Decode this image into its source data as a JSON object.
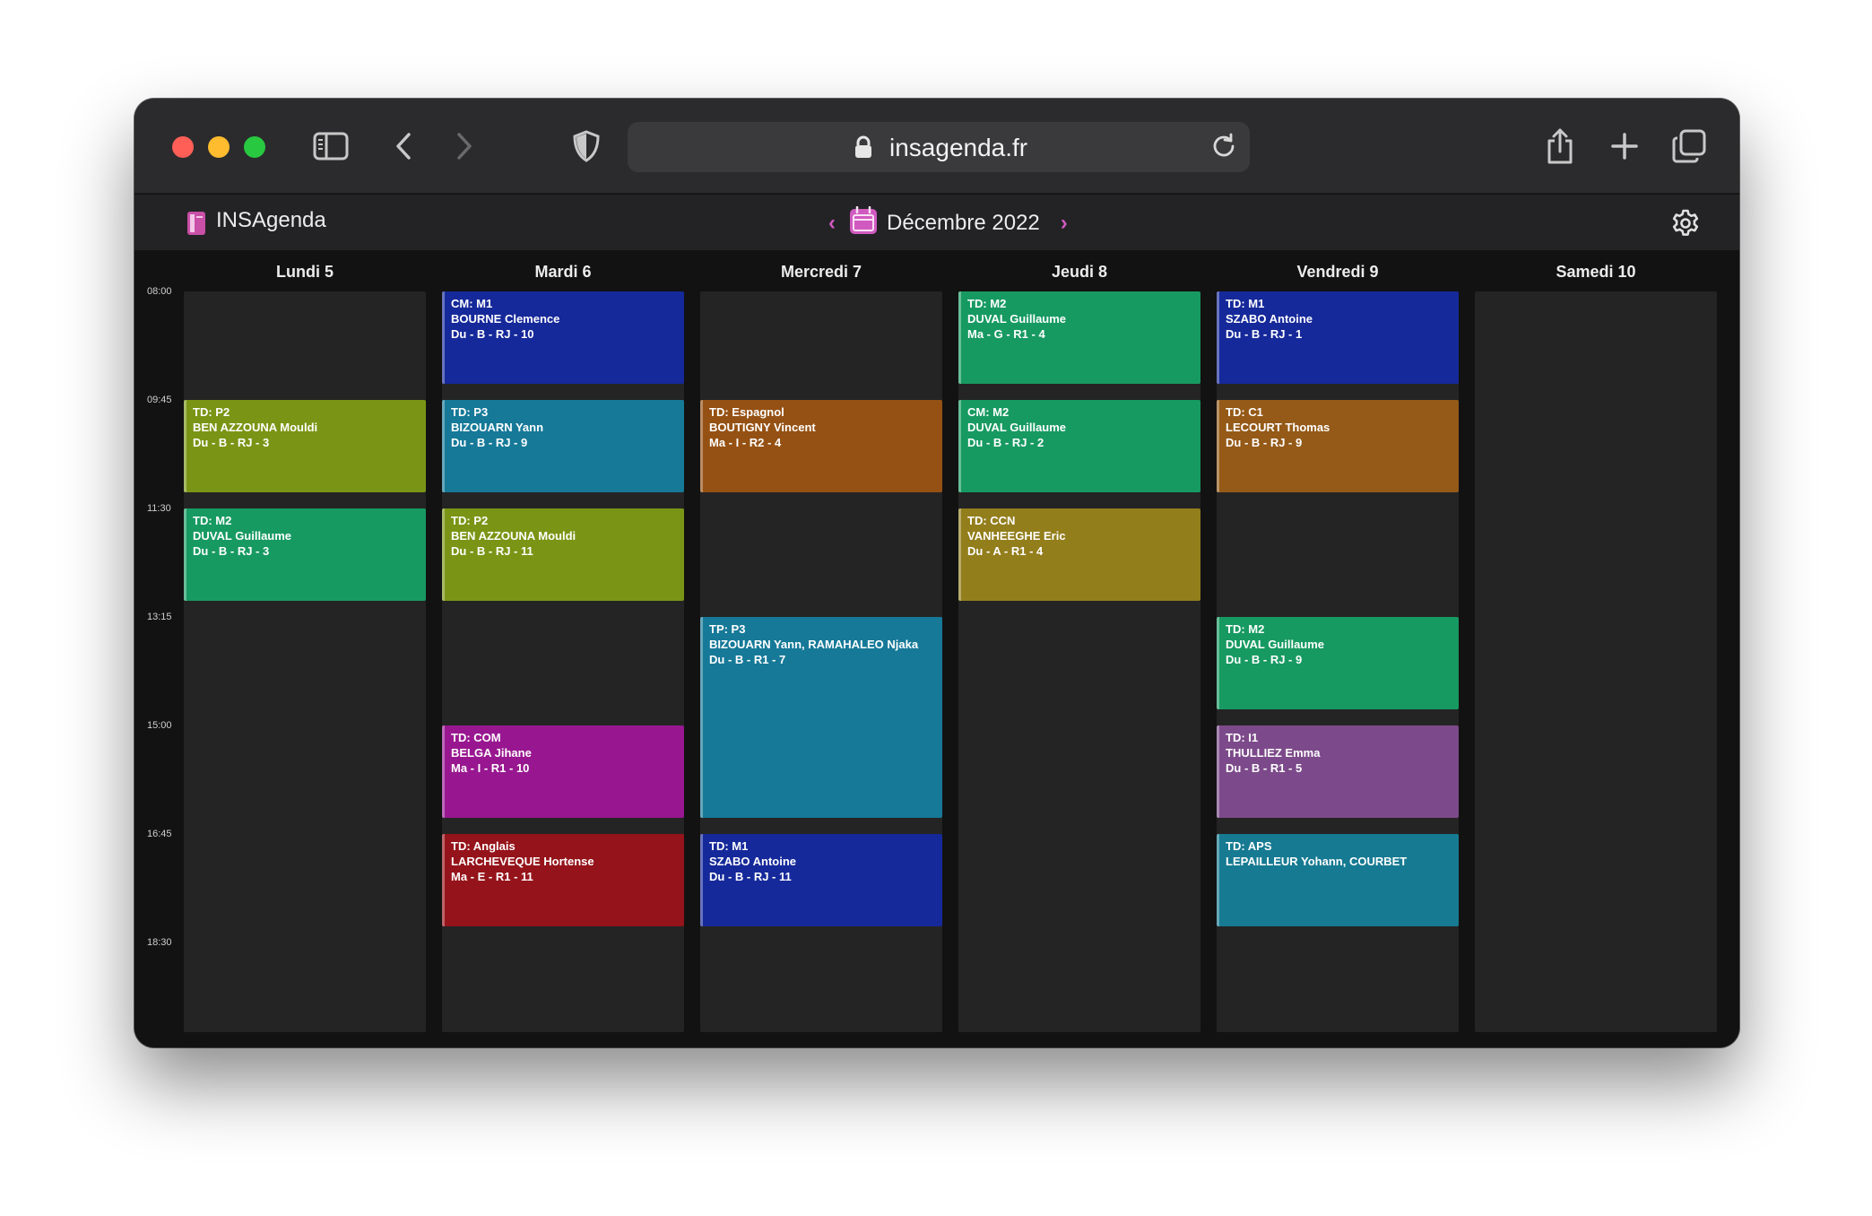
{
  "browser": {
    "url": "insagenda.fr"
  },
  "app": {
    "name": "INSAgenda",
    "month": "Décembre 2022",
    "prev_arrow": "‹",
    "next_arrow": "›",
    "accent_color": "#d05ac0"
  },
  "times": [
    "08:00",
    "09:45",
    "11:30",
    "13:15",
    "15:00",
    "16:45",
    "18:30"
  ],
  "days": [
    {
      "label": "Lundi 5",
      "events": [
        {
          "slot": 1,
          "span": 1,
          "color": "#7a9515",
          "lines": [
            "TD: P2",
            "BEN AZZOUNA Mouldi",
            "Du - B - RJ - 3"
          ]
        },
        {
          "slot": 2,
          "span": 1,
          "color": "#179a62",
          "lines": [
            "TD: M2",
            "DUVAL Guillaume",
            "Du - B - RJ - 3"
          ]
        }
      ]
    },
    {
      "label": "Mardi 6",
      "events": [
        {
          "slot": 0,
          "span": 1,
          "color": "#16299a",
          "lines": [
            "CM: M1",
            "BOURNE Clemence",
            "Du - B - RJ - 10"
          ]
        },
        {
          "slot": 1,
          "span": 1,
          "color": "#167998",
          "lines": [
            "TD: P3",
            "BIZOUARN Yann",
            "Du - B - RJ - 9"
          ]
        },
        {
          "slot": 2,
          "span": 1,
          "color": "#7a9515",
          "lines": [
            "TD: P2",
            "BEN AZZOUNA Mouldi",
            "Du - B - RJ - 11"
          ]
        },
        {
          "slot": 4,
          "span": 1,
          "color": "#981790",
          "lines": [
            "TD: COM",
            "BELGA Jihane",
            "Ma - I - R1 - 10"
          ]
        },
        {
          "slot": 5,
          "span": 1,
          "color": "#95131a",
          "lines": [
            "TD: Anglais",
            "LARCHEVEQUE Hortense",
            "Ma - E - R1 - 11"
          ]
        }
      ]
    },
    {
      "label": "Mercredi 7",
      "events": [
        {
          "slot": 1,
          "span": 1,
          "color": "#955113",
          "lines": [
            "TD: Espagnol",
            "BOUTIGNY Vincent",
            "Ma - I - R2 - 4"
          ]
        },
        {
          "slot": 3,
          "span": 2,
          "color": "#167998",
          "lines": [
            "TP: P3",
            "BIZOUARN Yann, RAMAHALEO Njaka",
            "Du - B - R1 - 7"
          ]
        },
        {
          "slot": 5,
          "span": 1,
          "color": "#16299a",
          "lines": [
            "TD: M1",
            "SZABO Antoine",
            "Du - B - RJ - 11"
          ]
        }
      ]
    },
    {
      "label": "Jeudi 8",
      "events": [
        {
          "slot": 0,
          "span": 1,
          "color": "#179a62",
          "lines": [
            "TD: M2",
            "DUVAL Guillaume",
            "Ma - G - R1 - 4"
          ]
        },
        {
          "slot": 1,
          "span": 1,
          "color": "#179a62",
          "lines": [
            "CM: M2",
            "DUVAL Guillaume",
            "Du - B - RJ - 2"
          ]
        },
        {
          "slot": 2,
          "span": 1,
          "color": "#937e1c",
          "lines": [
            "TD: CCN",
            "VANHEEGHE Eric",
            "Du - A - R1 - 4"
          ]
        }
      ]
    },
    {
      "label": "Vendredi 9",
      "events": [
        {
          "slot": 0,
          "span": 1,
          "color": "#16299a",
          "lines": [
            "TD: M1",
            "SZABO Antoine",
            "Du - B - RJ - 1"
          ]
        },
        {
          "slot": 1,
          "span": 1,
          "color": "#955a18",
          "lines": [
            "TD: C1",
            "LECOURT Thomas",
            "Du - B - RJ - 9"
          ]
        },
        {
          "slot": 3,
          "span": 1,
          "color": "#179a62",
          "lines": [
            "TD: M2",
            "DUVAL Guillaume",
            "Du - B - RJ - 9"
          ]
        },
        {
          "slot": 4,
          "span": 1,
          "color": "#7c4a8a",
          "lines": [
            "TD: I1",
            "THULLIEZ Emma",
            "Du - B - R1 - 5"
          ]
        },
        {
          "slot": 5,
          "span": 1,
          "color": "#167a92",
          "lines": [
            "TD: APS",
            "LEPAILLEUR Yohann, COURBET"
          ]
        }
      ]
    },
    {
      "label": "Samedi 10",
      "events": []
    }
  ]
}
